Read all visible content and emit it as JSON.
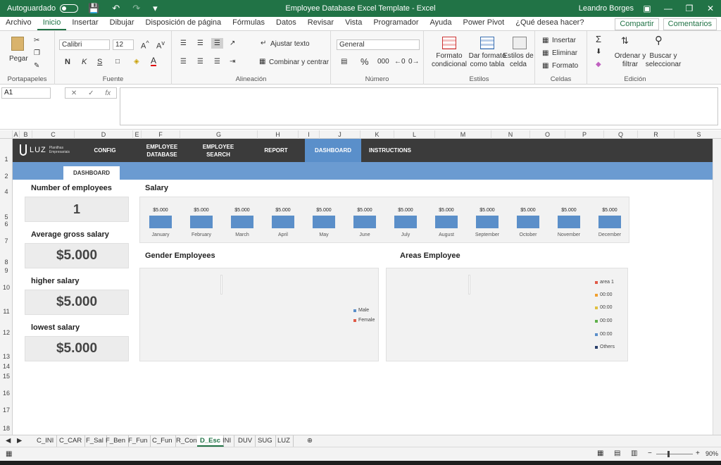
{
  "titlebar": {
    "autosave_label": "Autoguardado",
    "title": "Employee Database Excel Template  -  Excel",
    "user": "Leandro Borges"
  },
  "tabs": [
    "Archivo",
    "Inicio",
    "Insertar",
    "Dibujar",
    "Disposición de página",
    "Fórmulas",
    "Datos",
    "Revisar",
    "Vista",
    "Programador",
    "Ayuda",
    "Power Pivot",
    "¿Qué desea hacer?"
  ],
  "tabs_right": {
    "share": "Compartir",
    "comments": "Comentarios"
  },
  "ribbon": {
    "clipboard": {
      "paste": "Pegar",
      "label": "Portapapeles"
    },
    "font": {
      "name": "Calibri",
      "size": "12",
      "bold": "N",
      "italic": "K",
      "underline": "S",
      "label": "Fuente"
    },
    "align": {
      "wrap": "Ajustar texto",
      "merge": "Combinar y centrar",
      "label": "Alineación"
    },
    "number": {
      "format": "General",
      "percent": "%",
      "thousands": "000",
      "label": "Número"
    },
    "styles": {
      "cond": "Formato condicional",
      "table": "Dar formato como tabla",
      "cell": "Estilos de celda",
      "label": "Estilos"
    },
    "cells": {
      "insert": "Insertar",
      "delete": "Eliminar",
      "format": "Formato",
      "label": "Celdas"
    },
    "editing": {
      "sort": "Ordenar y filtrar",
      "find": "Buscar y seleccionar",
      "label": "Edición"
    }
  },
  "formula": {
    "namebox": "A1",
    "fx": "fx"
  },
  "columns": [
    "A",
    "B",
    "C",
    "D",
    "E",
    "F",
    "G",
    "H",
    "I",
    "J",
    "K",
    "L",
    "M",
    "N",
    "O",
    "P",
    "Q",
    "R",
    "S"
  ],
  "rows": [
    "1",
    "2",
    "4",
    "5",
    "6",
    "7",
    "8",
    "9",
    "10",
    "11",
    "12",
    "13",
    "14",
    "15",
    "16",
    "17",
    "18"
  ],
  "dashboard": {
    "logo": {
      "name": "LUZ",
      "sub_1": "Planilhas",
      "sub_2": "Empresariais"
    },
    "nav": [
      {
        "label_1": "CONFIG",
        "label_2": ""
      },
      {
        "label_1": "EMPLOYEE",
        "label_2": "DATABASE"
      },
      {
        "label_1": "EMPLOYEE",
        "label_2": "SEARCH"
      },
      {
        "label_1": "REPORT",
        "label_2": ""
      },
      {
        "label_1": "DASHBOARD",
        "label_2": ""
      },
      {
        "label_1": "INSTRUCTIONS",
        "label_2": ""
      }
    ],
    "subtab": "DASHBOARD",
    "kpis": [
      {
        "label": "Number of employees",
        "value": "1"
      },
      {
        "label": "Average gross salary",
        "value": "$5.000"
      },
      {
        "label": "higher salary",
        "value": "$5.000"
      },
      {
        "label": "lowest salary",
        "value": "$5.000"
      }
    ],
    "gender_title": "Gender Employees",
    "areas_title": "Areas Employee"
  },
  "chart_data": [
    {
      "type": "bar",
      "title": "Salary",
      "categories": [
        "January",
        "February",
        "March",
        "April",
        "May",
        "June",
        "July",
        "August",
        "September",
        "October",
        "November",
        "December"
      ],
      "values": [
        5000,
        5000,
        5000,
        5000,
        5000,
        5000,
        5000,
        5000,
        5000,
        5000,
        5000,
        5000
      ],
      "data_labels": [
        "$5.000",
        "$5.000",
        "$5.000",
        "$5.000",
        "$5.000",
        "$5.000",
        "$5.000",
        "$5.000",
        "$5.000",
        "$5.000",
        "$5.000",
        "$5.000"
      ],
      "bar_color": "#5b8fc9",
      "grid": false
    },
    {
      "type": "pie",
      "title": "Gender Employees",
      "legend": [
        {
          "name": "Male",
          "color": "#5b8fc9"
        },
        {
          "name": "Female",
          "color": "#e05a47"
        }
      ],
      "legend_position": "right"
    },
    {
      "type": "pie",
      "title": "Areas Employee",
      "legend": [
        {
          "name": "area 1",
          "color": "#e05a47"
        },
        {
          "name": "00:00",
          "color": "#f0a030"
        },
        {
          "name": "00:00",
          "color": "#e0c040"
        },
        {
          "name": "00:00",
          "color": "#5fb04a"
        },
        {
          "name": "00:00",
          "color": "#5b8fc9"
        },
        {
          "name": "Others",
          "color": "#2a3f6b"
        }
      ],
      "legend_position": "right"
    }
  ],
  "sheet_tabs": [
    "C_INI",
    "C_CAR",
    "F_Sal",
    "F_Ben",
    "F_Fun",
    "C_Fun",
    "R_Con",
    "D_Esc",
    "INI",
    "DUV",
    "SUG",
    "LUZ"
  ],
  "active_sheet": "D_Esc",
  "status": {
    "zoom": "90%"
  },
  "colors": {
    "excel_green": "#217346",
    "nav_dark": "#3b3b3b",
    "band_blue": "#6b9bd1"
  }
}
